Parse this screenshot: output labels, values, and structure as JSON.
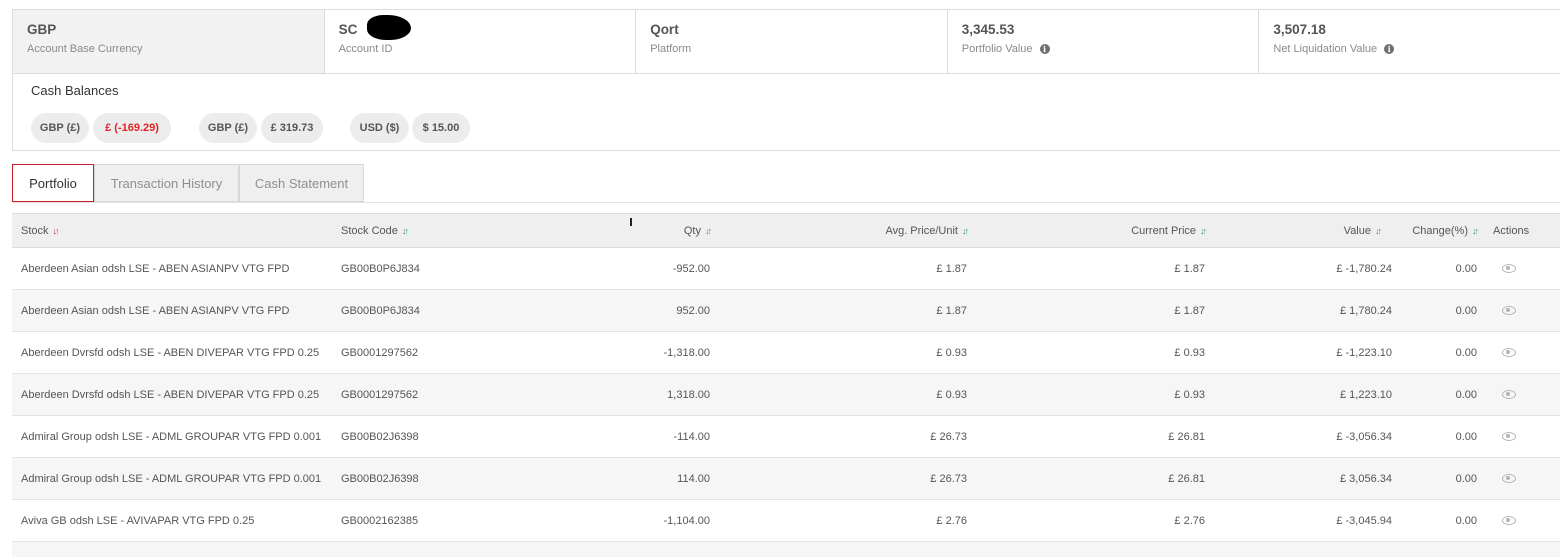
{
  "summary": {
    "base_currency": {
      "value": "GBP",
      "label": "Account Base Currency"
    },
    "account_id": {
      "value": "SC",
      "label": "Account ID"
    },
    "platform": {
      "value": "Qort",
      "label": "Platform"
    },
    "portfolio_value": {
      "value": "3,345.53",
      "label": "Portfolio Value"
    },
    "net_liquidation": {
      "value": "3,507.18",
      "label": "Net Liquidation Value"
    }
  },
  "cash": {
    "title": "Cash Balances",
    "balances": [
      {
        "currency": "GBP (£)",
        "amount": "£ (-169.29)"
      },
      {
        "currency": "GBP (£)",
        "amount": "£ 319.73"
      },
      {
        "currency": "USD ($)",
        "amount": "$ 15.00"
      }
    ]
  },
  "tabs": [
    "Portfolio",
    "Transaction History",
    "Cash Statement"
  ],
  "table": {
    "headers": {
      "stock": "Stock",
      "code": "Stock Code",
      "qty": "Qty",
      "avg": "Avg. Price/Unit",
      "current": "Current Price",
      "value": "Value",
      "change": "Change(%)",
      "actions": "Actions"
    },
    "rows": [
      {
        "stock": "Aberdeen Asian odsh LSE - ABEN ASIANPV VTG FPD",
        "code": "GB00B0P6J834",
        "qty": "-952.00",
        "avg": "£ 1.87",
        "current": "£ 1.87",
        "value": "£ -1,780.24",
        "change": "0.00"
      },
      {
        "stock": "Aberdeen Asian odsh LSE - ABEN ASIANPV VTG FPD",
        "code": "GB00B0P6J834",
        "qty": "952.00",
        "avg": "£ 1.87",
        "current": "£ 1.87",
        "value": "£ 1,780.24",
        "change": "0.00"
      },
      {
        "stock": "Aberdeen Dvrsfd odsh LSE - ABEN DIVEPAR VTG FPD 0.25",
        "code": "GB0001297562",
        "qty": "-1,318.00",
        "avg": "£ 0.93",
        "current": "£ 0.93",
        "value": "£ -1,223.10",
        "change": "0.00"
      },
      {
        "stock": "Aberdeen Dvrsfd odsh LSE - ABEN DIVEPAR VTG FPD 0.25",
        "code": "GB0001297562",
        "qty": "1,318.00",
        "avg": "£ 0.93",
        "current": "£ 0.93",
        "value": "£ 1,223.10",
        "change": "0.00"
      },
      {
        "stock": "Admiral Group odsh LSE - ADML GROUPAR VTG FPD 0.001",
        "code": "GB00B02J6398",
        "qty": "-114.00",
        "avg": "£ 26.73",
        "current": "£ 26.81",
        "value": "£ -3,056.34",
        "change": "0.00"
      },
      {
        "stock": "Admiral Group odsh LSE - ADML GROUPAR VTG FPD 0.001",
        "code": "GB00B02J6398",
        "qty": "114.00",
        "avg": "£ 26.73",
        "current": "£ 26.81",
        "value": "£ 3,056.34",
        "change": "0.00"
      },
      {
        "stock": "Aviva GB odsh LSE - AVIVAPAR VTG FPD 0.25",
        "code": "GB0002162385",
        "qty": "-1,104.00",
        "avg": "£ 2.76",
        "current": "£ 2.76",
        "value": "£ -3,045.94",
        "change": "0.00"
      }
    ]
  },
  "colors": {
    "accent": "#c8202b",
    "negative": "#e02424",
    "sort_up": "#2e9a4f"
  }
}
